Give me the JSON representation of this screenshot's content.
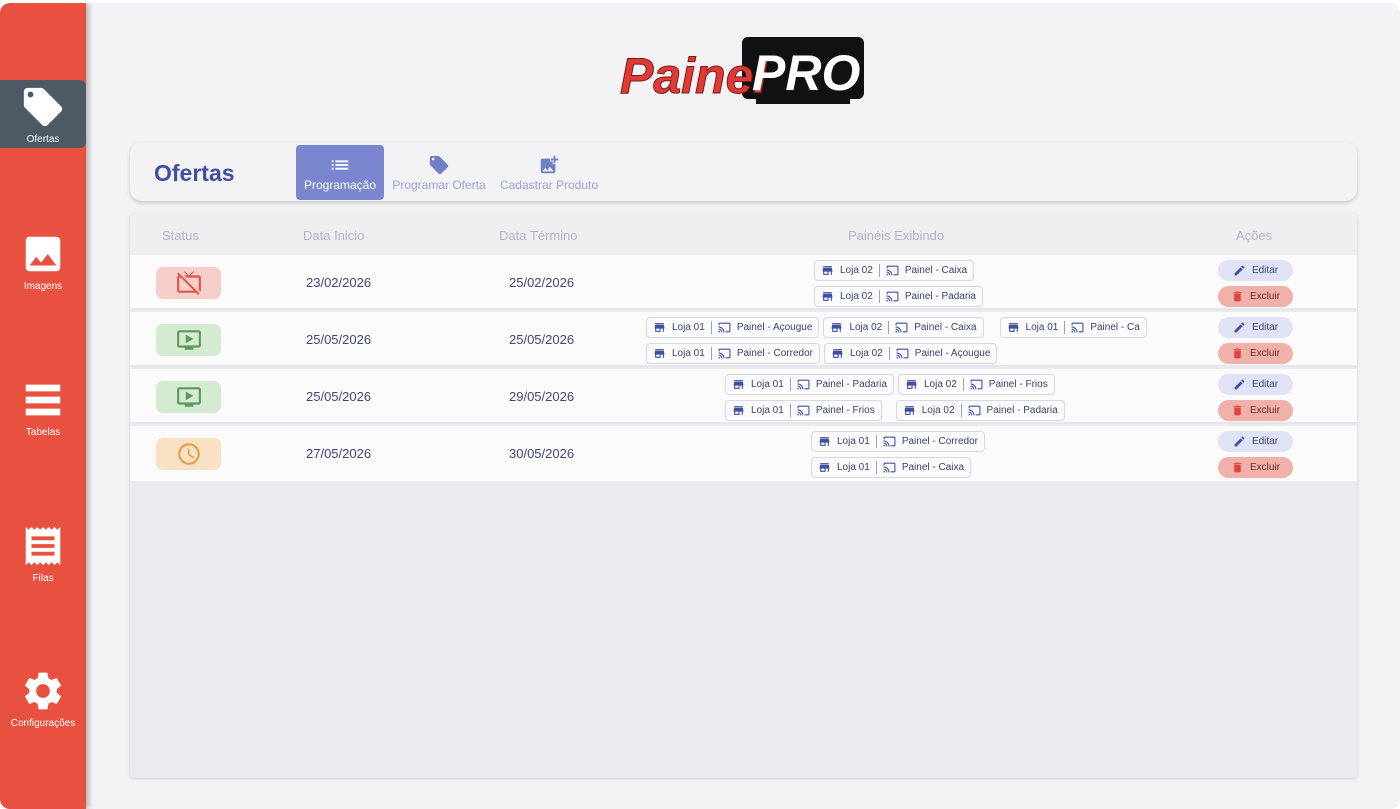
{
  "sidebar": {
    "items": [
      {
        "label": "Ofertas",
        "icon": "tag-icon",
        "active": true
      },
      {
        "label": "Imagens",
        "icon": "image-icon",
        "active": false
      },
      {
        "label": "Tabelas",
        "icon": "table-icon",
        "active": false
      },
      {
        "label": "Filas",
        "icon": "receipt-icon",
        "active": false
      },
      {
        "label": "Configurações",
        "icon": "gear-icon",
        "active": false
      }
    ]
  },
  "logo": {
    "text_left": "Painel",
    "text_right": "PRO"
  },
  "header": {
    "title": "Ofertas",
    "tabs": [
      {
        "label": "Programação",
        "icon": "list-icon",
        "active": true
      },
      {
        "label": "Programar Oferta",
        "icon": "tag-icon",
        "active": false
      },
      {
        "label": "Cadastrar Produto",
        "icon": "add-image-icon",
        "active": false
      }
    ]
  },
  "table": {
    "columns": [
      "Status",
      "Data Inicio",
      "Data Término",
      "Painéis Exibindo",
      "Ações"
    ],
    "rows": [
      {
        "status": "desativado",
        "status_icon": "tv-off-icon",
        "start": "23/02/2026",
        "end": "25/02/2026",
        "panels_line1": [
          {
            "loja": "Loja 02",
            "painel": "Painel - Caixa"
          }
        ],
        "panels_line2": [
          {
            "loja": "Loja 02",
            "painel": "Painel - Padaria"
          }
        ]
      },
      {
        "status": "ativo",
        "status_icon": "tv-play-icon",
        "start": "25/05/2026",
        "end": "25/05/2026",
        "panels_line1": [
          {
            "loja": "Loja 01",
            "painel": "Painel - Açougue"
          },
          {
            "loja": "Loja 02",
            "painel": "Painel - Caixa"
          },
          {
            "loja": "Loja 01",
            "painel": "Painel - Ca"
          }
        ],
        "panels_line2": [
          {
            "loja": "Loja 01",
            "painel": "Painel - Corredor"
          },
          {
            "loja": "Loja 02",
            "painel": "Painel - Açougue"
          }
        ]
      },
      {
        "status": "ativo",
        "status_icon": "tv-play-icon",
        "start": "25/05/2026",
        "end": "29/05/2026",
        "panels_line1": [
          {
            "loja": "Loja 01",
            "painel": "Painel - Padaria"
          },
          {
            "loja": "Loja 02",
            "painel": "Painel - Frios"
          }
        ],
        "panels_line2": [
          {
            "loja": "Loja 01",
            "painel": "Painel - Frios"
          },
          {
            "loja": "Loja 02",
            "painel": "Painel - Padaria"
          }
        ]
      },
      {
        "status": "agendado",
        "status_icon": "clock-icon",
        "start": "27/05/2026",
        "end": "30/05/2026",
        "panels_line1": [
          {
            "loja": "Loja 01",
            "painel": "Painel - Corredor"
          }
        ],
        "panels_line2": [
          {
            "loja": "Loja 01",
            "painel": "Painel - Caixa"
          }
        ]
      }
    ],
    "actions": {
      "edit": "Editar",
      "delete": "Excluir"
    }
  },
  "colors": {
    "sidebar": "#e8503f",
    "sidebar_active": "#4b5a64",
    "accent": "#3f4fa3",
    "tab_active": "#7b86d0",
    "status_off_bg": "#f6cfcb",
    "status_on_bg": "#d4ebd2",
    "status_wait_bg": "#f9e2c4"
  }
}
